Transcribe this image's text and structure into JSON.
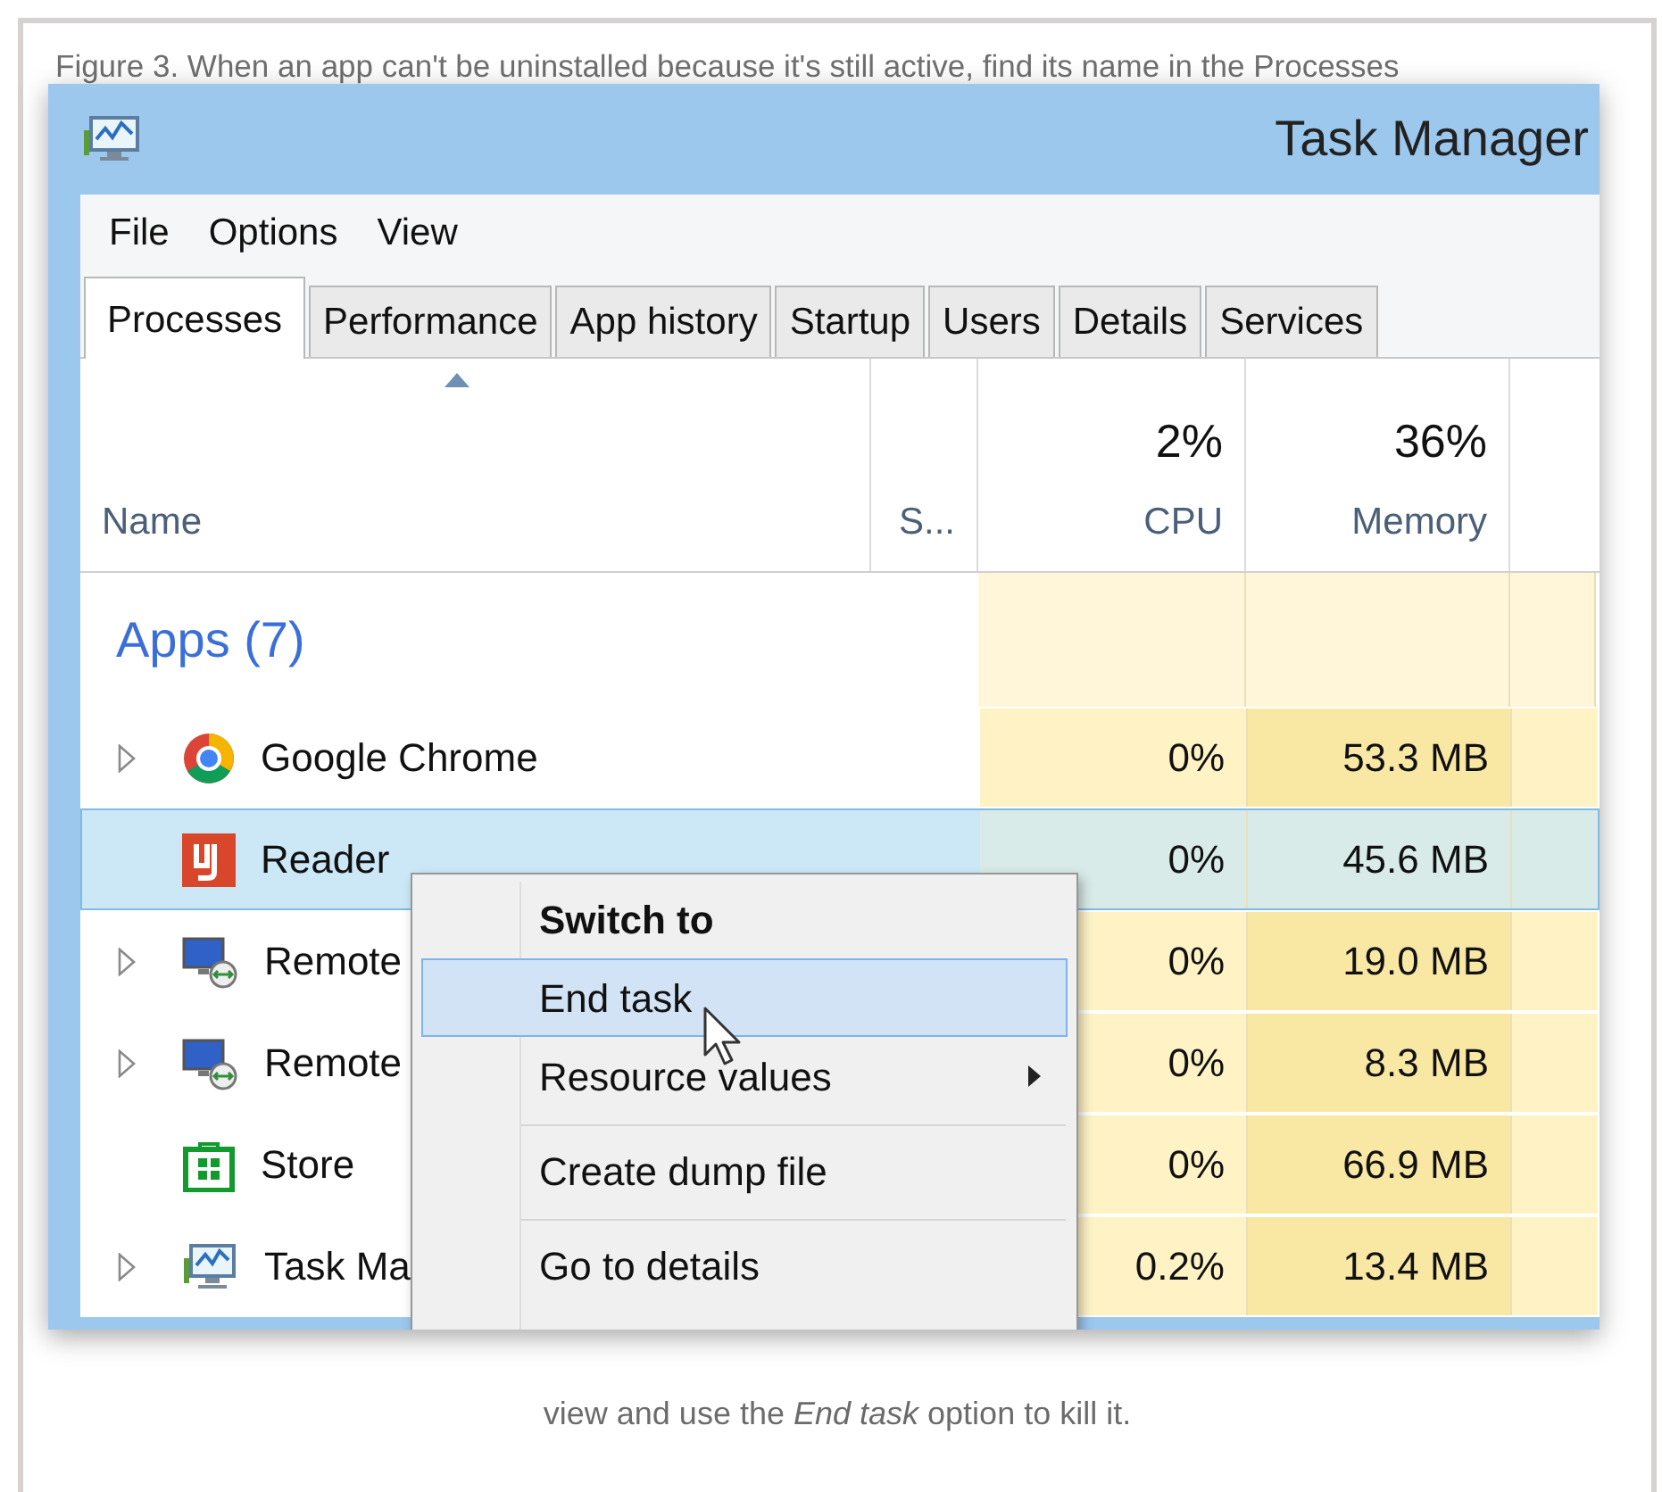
{
  "caption_top": "Figure 3. When an app can't be uninstalled because it's still active, find its name in the Processes",
  "window": {
    "title": "Task Manager"
  },
  "menu_bar": [
    "File",
    "Options",
    "View"
  ],
  "tabs": [
    {
      "label": "Processes",
      "selected": true
    },
    {
      "label": "Performance",
      "selected": false
    },
    {
      "label": "App history",
      "selected": false
    },
    {
      "label": "Startup",
      "selected": false
    },
    {
      "label": "Users",
      "selected": false
    },
    {
      "label": "Details",
      "selected": false
    },
    {
      "label": "Services",
      "selected": false
    }
  ],
  "table": {
    "columns": [
      {
        "label": "Name"
      },
      {
        "label": "S..."
      },
      {
        "label": "CPU",
        "total": "2%"
      },
      {
        "label": "Memory",
        "total": "36%"
      }
    ],
    "group": {
      "label": "Apps (7)"
    },
    "rows": [
      {
        "kind": "browser",
        "name": "Google Chrome",
        "expander": true,
        "selected": false,
        "cpu": "0%",
        "memory": "53.3 MB"
      },
      {
        "kind": "reader",
        "name": "Reader",
        "expander": false,
        "selected": true,
        "cpu": "0%",
        "memory": "45.6 MB"
      },
      {
        "kind": "remote",
        "name": "Remote",
        "expander": true,
        "selected": false,
        "cpu": "0%",
        "memory": "19.0 MB"
      },
      {
        "kind": "remote",
        "name": "Remote",
        "expander": true,
        "selected": false,
        "cpu": "0%",
        "memory": "8.3 MB"
      },
      {
        "kind": "store",
        "name": "Store",
        "expander": false,
        "selected": false,
        "cpu": "0%",
        "memory": "66.9 MB"
      },
      {
        "kind": "monitor",
        "name": "Task Ma",
        "expander": true,
        "selected": false,
        "cpu": "0.2%",
        "memory": "13.4 MB"
      }
    ]
  },
  "context_menu": [
    {
      "label": "Switch to",
      "default": true,
      "selected": false,
      "submenu": false,
      "separator_before": false
    },
    {
      "label": "End task",
      "default": false,
      "selected": true,
      "submenu": false,
      "separator_before": false
    },
    {
      "label": "Resource values",
      "default": false,
      "selected": false,
      "submenu": true,
      "separator_before": false
    },
    {
      "label": "Create dump file",
      "default": false,
      "selected": false,
      "submenu": false,
      "separator_before": true
    },
    {
      "label": "Go to details",
      "default": false,
      "selected": false,
      "submenu": false,
      "separator_before": true
    }
  ],
  "caption_bottom": "view and use the *End task* option to kill it."
}
